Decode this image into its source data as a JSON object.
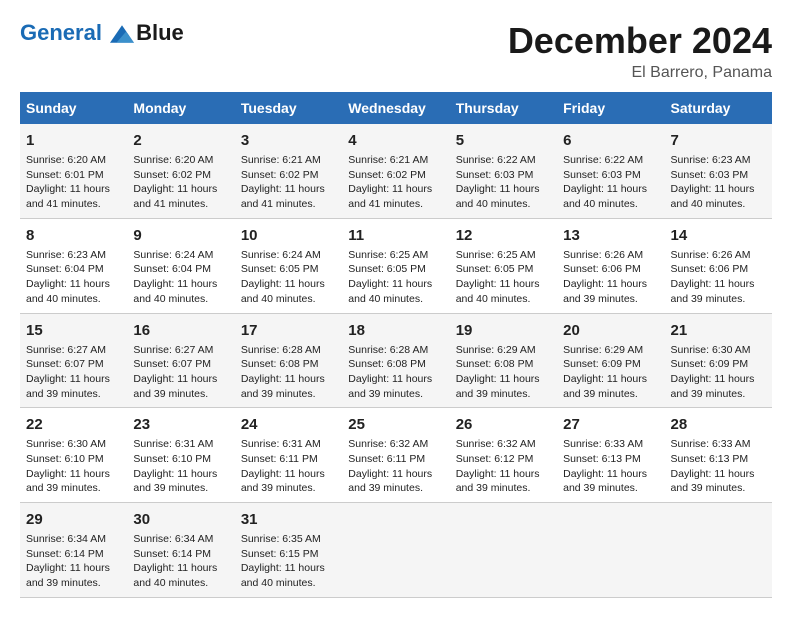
{
  "logo": {
    "line1": "General",
    "line2": "Blue"
  },
  "title": "December 2024",
  "subtitle": "El Barrero, Panama",
  "days_of_week": [
    "Sunday",
    "Monday",
    "Tuesday",
    "Wednesday",
    "Thursday",
    "Friday",
    "Saturday"
  ],
  "weeks": [
    [
      {
        "day": 1,
        "sunrise": "6:20 AM",
        "sunset": "6:01 PM",
        "daylight": "11 hours and 41 minutes."
      },
      {
        "day": 2,
        "sunrise": "6:20 AM",
        "sunset": "6:02 PM",
        "daylight": "11 hours and 41 minutes."
      },
      {
        "day": 3,
        "sunrise": "6:21 AM",
        "sunset": "6:02 PM",
        "daylight": "11 hours and 41 minutes."
      },
      {
        "day": 4,
        "sunrise": "6:21 AM",
        "sunset": "6:02 PM",
        "daylight": "11 hours and 41 minutes."
      },
      {
        "day": 5,
        "sunrise": "6:22 AM",
        "sunset": "6:03 PM",
        "daylight": "11 hours and 40 minutes."
      },
      {
        "day": 6,
        "sunrise": "6:22 AM",
        "sunset": "6:03 PM",
        "daylight": "11 hours and 40 minutes."
      },
      {
        "day": 7,
        "sunrise": "6:23 AM",
        "sunset": "6:03 PM",
        "daylight": "11 hours and 40 minutes."
      }
    ],
    [
      {
        "day": 8,
        "sunrise": "6:23 AM",
        "sunset": "6:04 PM",
        "daylight": "11 hours and 40 minutes."
      },
      {
        "day": 9,
        "sunrise": "6:24 AM",
        "sunset": "6:04 PM",
        "daylight": "11 hours and 40 minutes."
      },
      {
        "day": 10,
        "sunrise": "6:24 AM",
        "sunset": "6:05 PM",
        "daylight": "11 hours and 40 minutes."
      },
      {
        "day": 11,
        "sunrise": "6:25 AM",
        "sunset": "6:05 PM",
        "daylight": "11 hours and 40 minutes."
      },
      {
        "day": 12,
        "sunrise": "6:25 AM",
        "sunset": "6:05 PM",
        "daylight": "11 hours and 40 minutes."
      },
      {
        "day": 13,
        "sunrise": "6:26 AM",
        "sunset": "6:06 PM",
        "daylight": "11 hours and 39 minutes."
      },
      {
        "day": 14,
        "sunrise": "6:26 AM",
        "sunset": "6:06 PM",
        "daylight": "11 hours and 39 minutes."
      }
    ],
    [
      {
        "day": 15,
        "sunrise": "6:27 AM",
        "sunset": "6:07 PM",
        "daylight": "11 hours and 39 minutes."
      },
      {
        "day": 16,
        "sunrise": "6:27 AM",
        "sunset": "6:07 PM",
        "daylight": "11 hours and 39 minutes."
      },
      {
        "day": 17,
        "sunrise": "6:28 AM",
        "sunset": "6:08 PM",
        "daylight": "11 hours and 39 minutes."
      },
      {
        "day": 18,
        "sunrise": "6:28 AM",
        "sunset": "6:08 PM",
        "daylight": "11 hours and 39 minutes."
      },
      {
        "day": 19,
        "sunrise": "6:29 AM",
        "sunset": "6:08 PM",
        "daylight": "11 hours and 39 minutes."
      },
      {
        "day": 20,
        "sunrise": "6:29 AM",
        "sunset": "6:09 PM",
        "daylight": "11 hours and 39 minutes."
      },
      {
        "day": 21,
        "sunrise": "6:30 AM",
        "sunset": "6:09 PM",
        "daylight": "11 hours and 39 minutes."
      }
    ],
    [
      {
        "day": 22,
        "sunrise": "6:30 AM",
        "sunset": "6:10 PM",
        "daylight": "11 hours and 39 minutes."
      },
      {
        "day": 23,
        "sunrise": "6:31 AM",
        "sunset": "6:10 PM",
        "daylight": "11 hours and 39 minutes."
      },
      {
        "day": 24,
        "sunrise": "6:31 AM",
        "sunset": "6:11 PM",
        "daylight": "11 hours and 39 minutes."
      },
      {
        "day": 25,
        "sunrise": "6:32 AM",
        "sunset": "6:11 PM",
        "daylight": "11 hours and 39 minutes."
      },
      {
        "day": 26,
        "sunrise": "6:32 AM",
        "sunset": "6:12 PM",
        "daylight": "11 hours and 39 minutes."
      },
      {
        "day": 27,
        "sunrise": "6:33 AM",
        "sunset": "6:13 PM",
        "daylight": "11 hours and 39 minutes."
      },
      {
        "day": 28,
        "sunrise": "6:33 AM",
        "sunset": "6:13 PM",
        "daylight": "11 hours and 39 minutes."
      }
    ],
    [
      {
        "day": 29,
        "sunrise": "6:34 AM",
        "sunset": "6:14 PM",
        "daylight": "11 hours and 39 minutes."
      },
      {
        "day": 30,
        "sunrise": "6:34 AM",
        "sunset": "6:14 PM",
        "daylight": "11 hours and 40 minutes."
      },
      {
        "day": 31,
        "sunrise": "6:35 AM",
        "sunset": "6:15 PM",
        "daylight": "11 hours and 40 minutes."
      },
      null,
      null,
      null,
      null
    ]
  ],
  "labels": {
    "sunrise": "Sunrise:",
    "sunset": "Sunset:",
    "daylight": "Daylight:"
  }
}
